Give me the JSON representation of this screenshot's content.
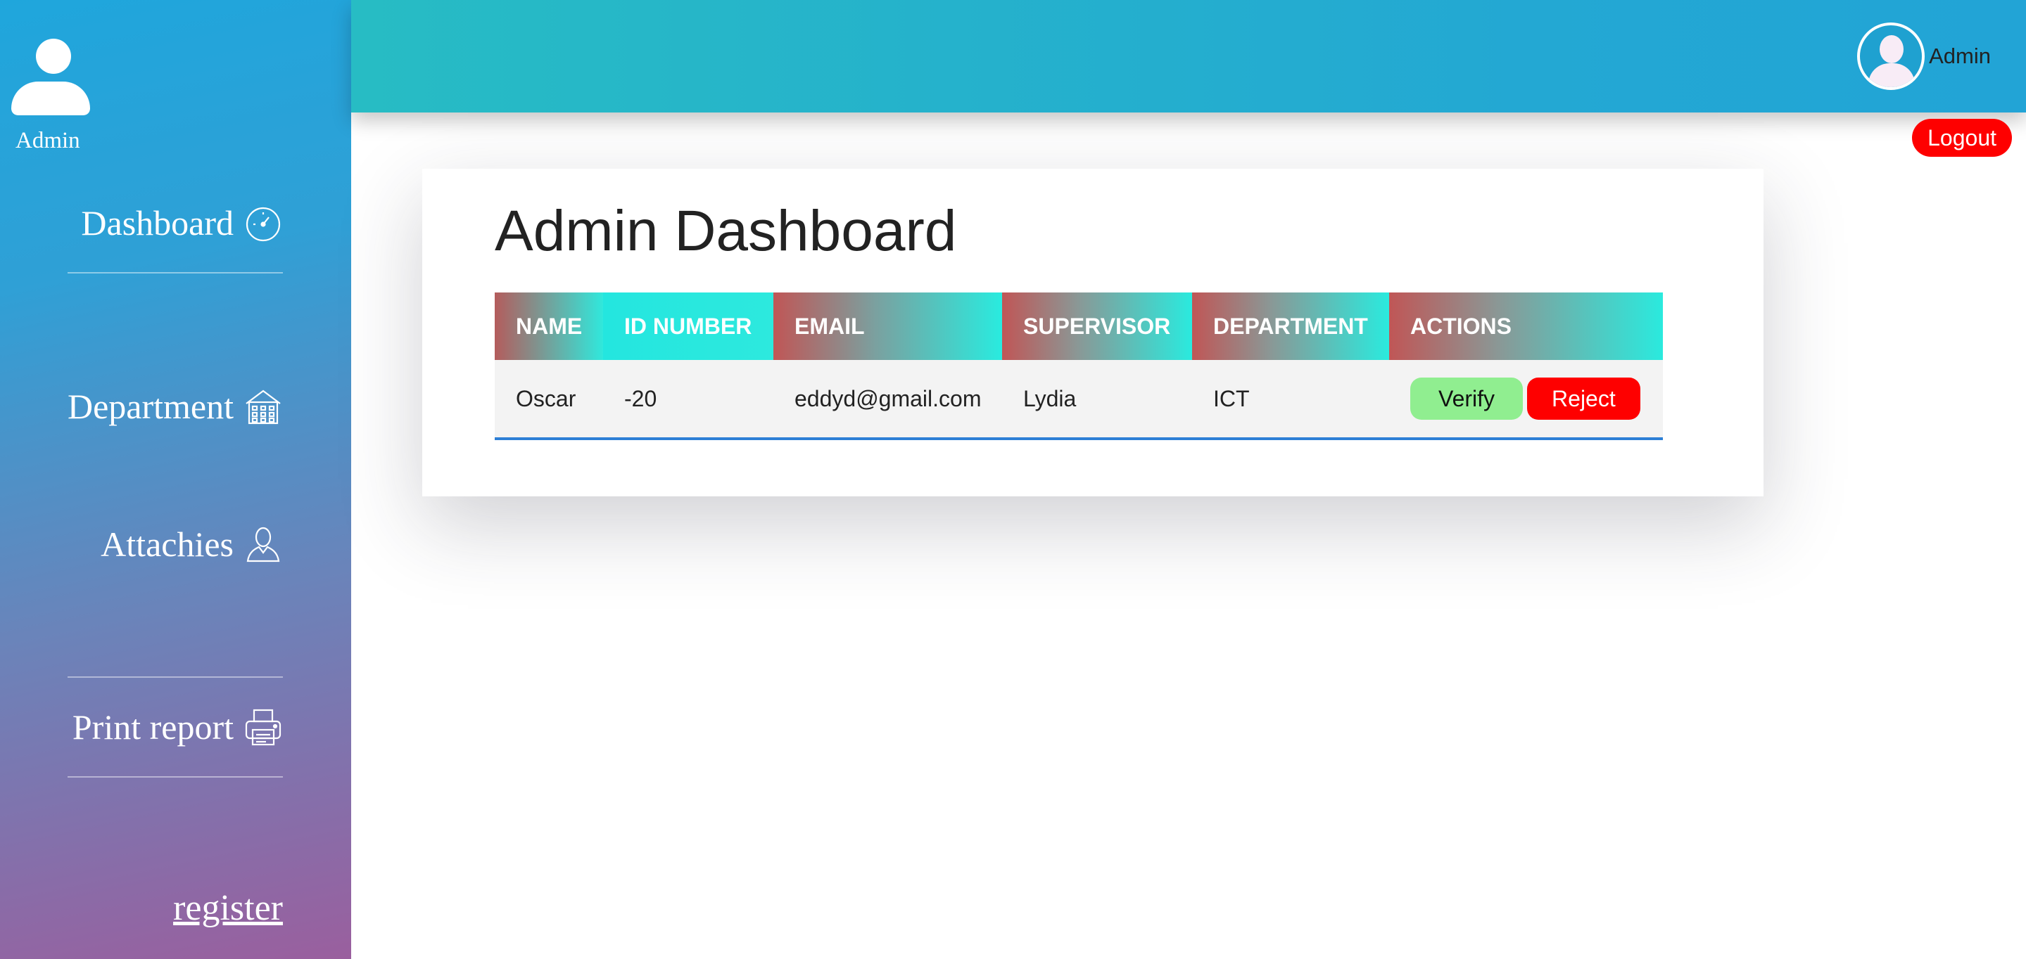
{
  "sidebar": {
    "profile_label": "Admin",
    "nav": [
      {
        "label": "Dashboard",
        "icon": "speedometer-icon"
      },
      {
        "label": "Department",
        "icon": "building-icon"
      },
      {
        "label": "Attachies",
        "icon": "person-icon"
      },
      {
        "label": "Print report",
        "icon": "printer-icon"
      }
    ],
    "register_label": "register"
  },
  "header": {
    "user_name": "Admin",
    "logout_label": "Logout"
  },
  "main": {
    "title": "Admin Dashboard",
    "table": {
      "columns": [
        "NAME",
        "ID NUMBER",
        "EMAIL",
        "SUPERVISOR",
        "DEPARTMENT",
        "ACTIONS"
      ],
      "rows": [
        {
          "name": "Oscar",
          "id_number": "-20",
          "email": "eddyd@gmail.com",
          "supervisor": "Lydia",
          "department": "ICT"
        }
      ],
      "verify_label": "Verify",
      "reject_label": "Reject"
    }
  },
  "colors": {
    "accent": "#22a4d6",
    "logout": "#fe0000",
    "verify": "#90ee90",
    "reject": "#fe0000"
  }
}
